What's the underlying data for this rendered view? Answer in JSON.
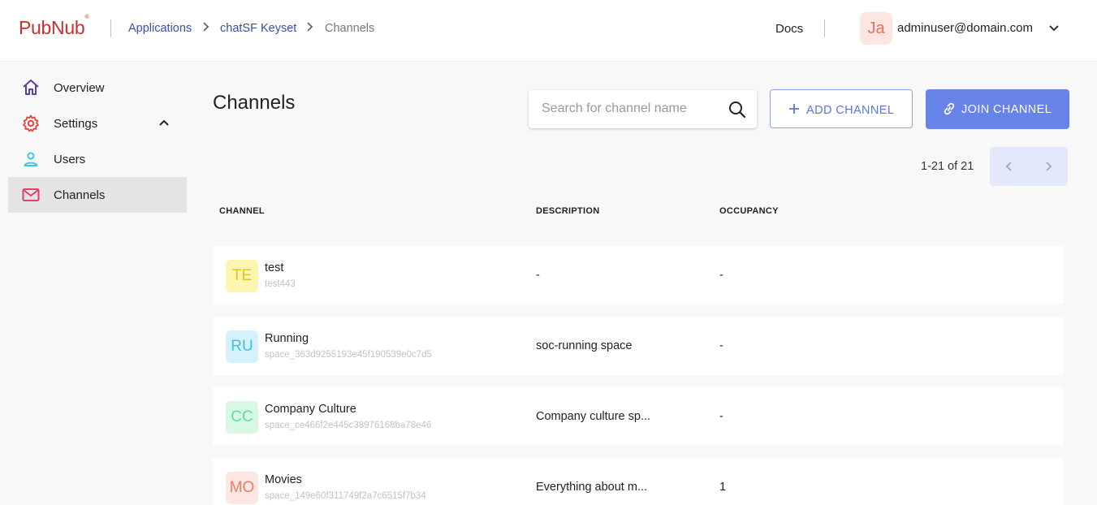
{
  "header": {
    "logo": "PubNub",
    "logo_mark": "®",
    "breadcrumbs": [
      "Applications",
      "chatSF Keyset",
      "Channels"
    ],
    "docs": "Docs",
    "avatar_initials": "Ja",
    "user_email": "adminuser@domain.com"
  },
  "sidebar": {
    "items": [
      {
        "label": "Overview",
        "icon": "home-icon"
      },
      {
        "label": "Settings",
        "icon": "gear-icon"
      },
      {
        "label": "Users",
        "icon": "user-icon"
      },
      {
        "label": "Channels",
        "icon": "mail-icon",
        "active": true
      }
    ]
  },
  "main": {
    "title": "Channels",
    "search_placeholder": "Search for channel name",
    "add_label": "ADD CHANNEL",
    "join_label": "JOIN CHANNEL",
    "pagination": "1-21 of 21",
    "columns": [
      "CHANNEL",
      "DESCRIPTION",
      "OCCUPANCY"
    ],
    "rows": [
      {
        "initials": "TE",
        "name": "test",
        "id": "test443",
        "description": "-",
        "occupancy": "-",
        "avatar_bg": "#fdf6b2",
        "avatar_fg": "#e6c21c"
      },
      {
        "initials": "RU",
        "name": "Running",
        "id": "space_363d9255193e45f190539e0c7d5",
        "description": "soc-running space",
        "occupancy": "-",
        "avatar_bg": "#d5f2fc",
        "avatar_fg": "#38c3e8"
      },
      {
        "initials": "CC",
        "name": "Company Culture",
        "id": "space_ce466f2e445c38976168ba78e46",
        "description": "Company culture sp...",
        "occupancy": "-",
        "avatar_bg": "#d8f8e6",
        "avatar_fg": "#5fdc9a"
      },
      {
        "initials": "MO",
        "name": "Movies",
        "id": "space_149e60f311749f2a7c6515f7b34",
        "description": "Everything about m...",
        "occupancy": "1",
        "avatar_bg": "#fde7e3",
        "avatar_fg": "#ec7a66"
      }
    ]
  },
  "colors": {
    "brand_red": "#c9302c",
    "accent_blue": "#6583e8",
    "link_blue": "#3a4fa6"
  }
}
